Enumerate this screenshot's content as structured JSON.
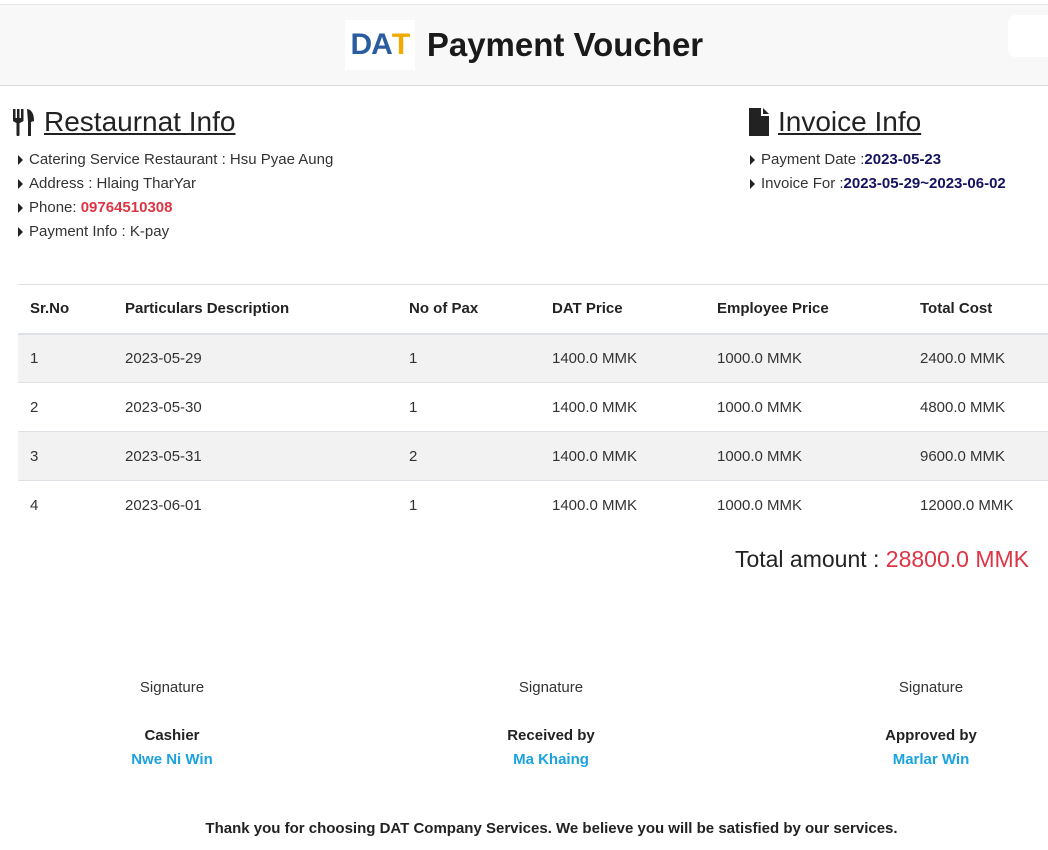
{
  "header": {
    "logo_text_1": "DA",
    "logo_text_2": "T",
    "title": "Payment Voucher"
  },
  "restaurant": {
    "title": "Restaurnat Info",
    "icon": "utensils-icon",
    "catering_label": "Catering Service Restaurant : Hsu Pyae Aung",
    "address_label": "Address : Hlaing TharYar",
    "phone_label": "Phone: ",
    "phone_value": "09764510308",
    "payment_label": "Payment Info : K-pay"
  },
  "invoice": {
    "title": "Invoice Info",
    "icon": "file-icon",
    "date_label": "Payment Date :",
    "date_value": "2023-05-23",
    "for_label": "Invoice For :",
    "for_value": "2023-05-29~2023-06-02"
  },
  "table": {
    "headers": [
      "Sr.No",
      "Particulars Description",
      "No of Pax",
      "DAT Price",
      "Employee Price",
      "Total Cost"
    ],
    "rows": [
      [
        "1",
        "2023-05-29",
        "1",
        "1400.0 MMK",
        "1000.0 MMK",
        "2400.0 MMK"
      ],
      [
        "2",
        "2023-05-30",
        "1",
        "1400.0 MMK",
        "1000.0 MMK",
        "4800.0 MMK"
      ],
      [
        "3",
        "2023-05-31",
        "2",
        "1400.0 MMK",
        "1000.0 MMK",
        "9600.0 MMK"
      ],
      [
        "4",
        "2023-06-01",
        "1",
        "1400.0 MMK",
        "1000.0 MMK",
        "12000.0 MMK"
      ]
    ]
  },
  "total": {
    "label": "Total amount : ",
    "amount": "28800.0 MMK"
  },
  "signatures": [
    {
      "label": "Signature",
      "role": "Cashier",
      "name": "Nwe Ni Win"
    },
    {
      "label": "Signature",
      "role": "Received by",
      "name": "Ma Khaing"
    },
    {
      "label": "Signature",
      "role": "Approved by",
      "name": "Marlar Win"
    }
  ],
  "footer": {
    "text": "Thank you for choosing DAT Company Services. We believe you will be satisfied by our services."
  },
  "colors": {
    "accent_red": "#dc3545",
    "navy": "#131360",
    "signature_blue": "#1aa3e0",
    "logo_blue": "#2a5d9f",
    "logo_yellow": "#f2a900"
  }
}
